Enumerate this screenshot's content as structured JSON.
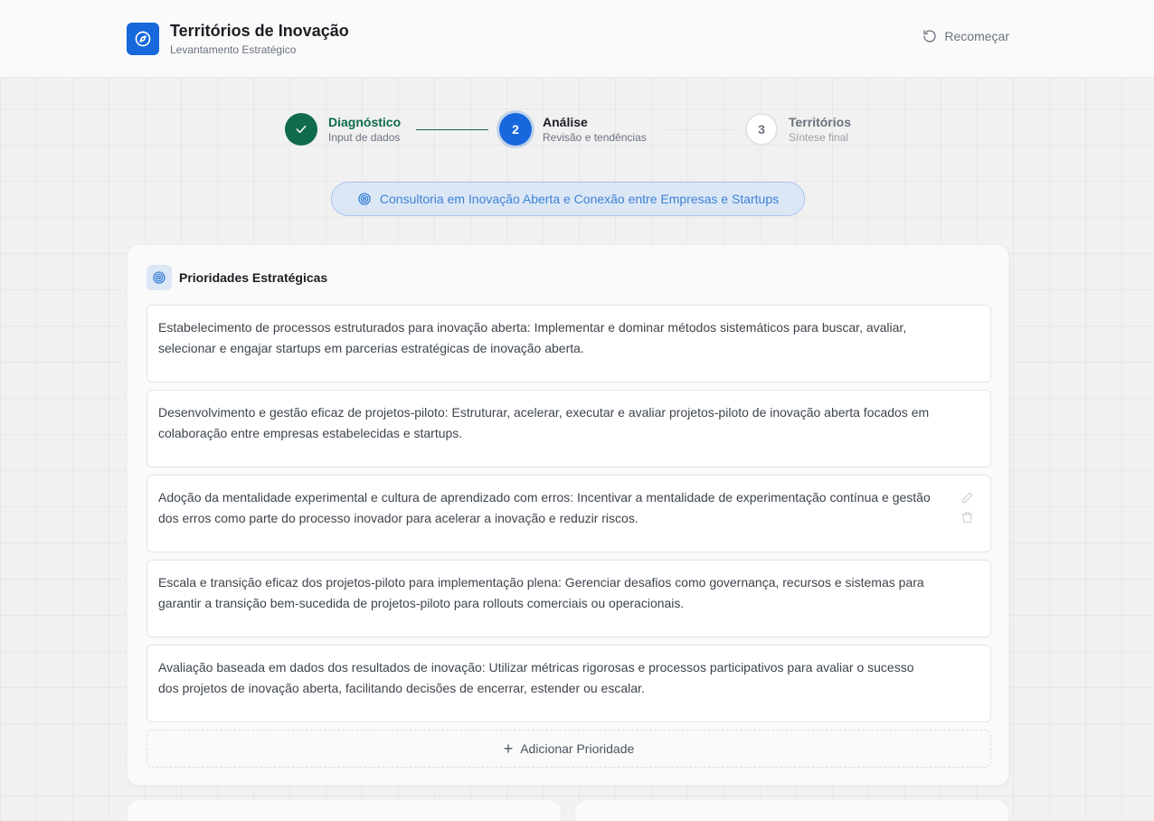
{
  "header": {
    "title": "Territórios de Inovação",
    "subtitle": "Levantamento Estratégico",
    "restart_label": "Recomeçar",
    "brand_color": "#1668dc"
  },
  "stepper": {
    "steps": [
      {
        "number": "1",
        "label": "Diagnóstico",
        "sub": "Input de dados",
        "status": "completed"
      },
      {
        "number": "2",
        "label": "Análise",
        "sub": "Revisão e tendências",
        "status": "active"
      },
      {
        "number": "3",
        "label": "Territórios",
        "sub": "Síntese final",
        "status": "pending"
      }
    ]
  },
  "consultancy": {
    "label": "Consultoria em Inovação Aberta e Conexão entre Empresas e Startups"
  },
  "priorities": {
    "title": "Prioridades Estratégicas",
    "items": [
      "Estabelecimento de processos estruturados para inovação aberta: Implementar e dominar métodos sistemáticos para buscar, avaliar, selecionar e engajar startups em parcerias estratégicas de inovação aberta.",
      "Desenvolvimento e gestão eficaz de projetos-piloto: Estruturar, acelerar, executar e avaliar projetos-piloto de inovação aberta focados em colaboração entre empresas estabelecidas e startups.",
      "Adoção da mentalidade experimental e cultura de aprendizado com erros: Incentivar a mentalidade de experimentação contínua e gestão dos erros como parte do processo inovador para acelerar a inovação e reduzir riscos.",
      "Escala e transição eficaz dos projetos-piloto para implementação plena: Gerenciar desafios como governança, recursos e sistemas para garantir a transição bem-sucedida de projetos-piloto para rollouts comerciais ou operacionais.",
      "Avaliação baseada em dados dos resultados de inovação: Utilizar métricas rigorosas e processos participativos para avaliar o sucesso dos projetos de inovação aberta, facilitando decisões de encerrar, estender ou escalar."
    ],
    "add_label": "Adicionar Prioridade"
  }
}
